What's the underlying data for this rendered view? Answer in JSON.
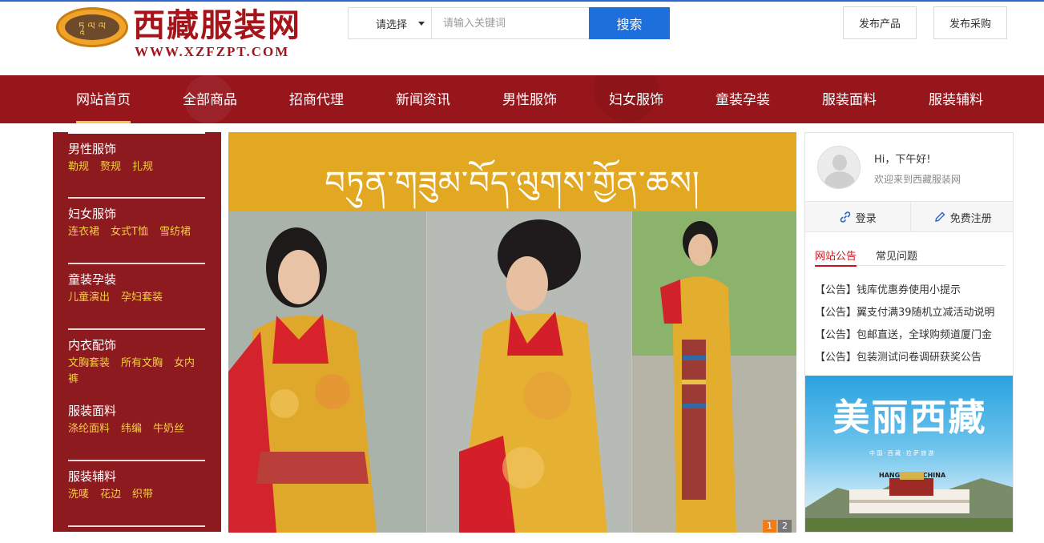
{
  "logo": {
    "name_cn": "西藏服装网",
    "url_text": "WWW.XZFZPT.COM",
    "emblem_text": "ཏཱ ལ ལ"
  },
  "search": {
    "select_value": "请选择",
    "placeholder": "请输入关键词",
    "button_label": "搜索"
  },
  "header_buttons": {
    "publish_product": "发布产品",
    "publish_purchase": "发布采购"
  },
  "nav": [
    {
      "label": "网站首页",
      "active": true
    },
    {
      "label": "全部商品"
    },
    {
      "label": "招商代理"
    },
    {
      "label": "新闻资讯"
    },
    {
      "label": "男性服饰"
    },
    {
      "label": "妇女服饰"
    },
    {
      "label": "童装孕装"
    },
    {
      "label": "服装面料"
    },
    {
      "label": "服装辅料"
    }
  ],
  "categories": [
    {
      "title": "男性服饰",
      "links": [
        "勒规",
        "赘规",
        "扎规"
      ]
    },
    {
      "title": "妇女服饰",
      "links": [
        "连衣裙",
        "女式T恤",
        "雪纺裙"
      ]
    },
    {
      "title": "童装孕装",
      "links": [
        "儿童演出",
        "孕妇套装"
      ]
    },
    {
      "title": "内衣配饰",
      "links": [
        "文胸套装",
        "所有文胸",
        "女内裤"
      ]
    },
    {
      "title": "服装面料",
      "links": [
        "涤纶面料",
        "纬编",
        "牛奶丝"
      ]
    },
    {
      "title": "服装辅料",
      "links": [
        "洗唛",
        "花边",
        "织带"
      ]
    }
  ],
  "banner": {
    "headline": "བཏུན་གཟུམ་བོད་ལུགས་གྱོན་ཆས།",
    "pager": [
      "1",
      "2"
    ],
    "active_page": 1
  },
  "user": {
    "greeting": "Hi，下午好!",
    "welcome": "欢迎来到西藏服装网",
    "login": "登录",
    "register": "免费注册"
  },
  "notice_tabs": [
    "网站公告",
    "常见问题"
  ],
  "notices": [
    "【公告】钱库优惠券使用小提示",
    "【公告】翼支付满39随机立减活动说明",
    "【公告】包邮直送，全球购频道厦门金",
    "【公告】包装测试问卷调研获奖公告"
  ],
  "ad": {
    "title": "美丽西藏",
    "subtitle": "中 国 · 西 藏 · 拉 萨 旅 游",
    "city": "HANGZHOU CHINA"
  },
  "colors": {
    "nav_bg": "#96161c",
    "sidebar_bg": "#8d1a1f",
    "accent_blue": "#1d6fdc",
    "link_yellow": "#f4d03f",
    "active_red": "#c7161e",
    "banner_yellow": "#e2a821"
  }
}
